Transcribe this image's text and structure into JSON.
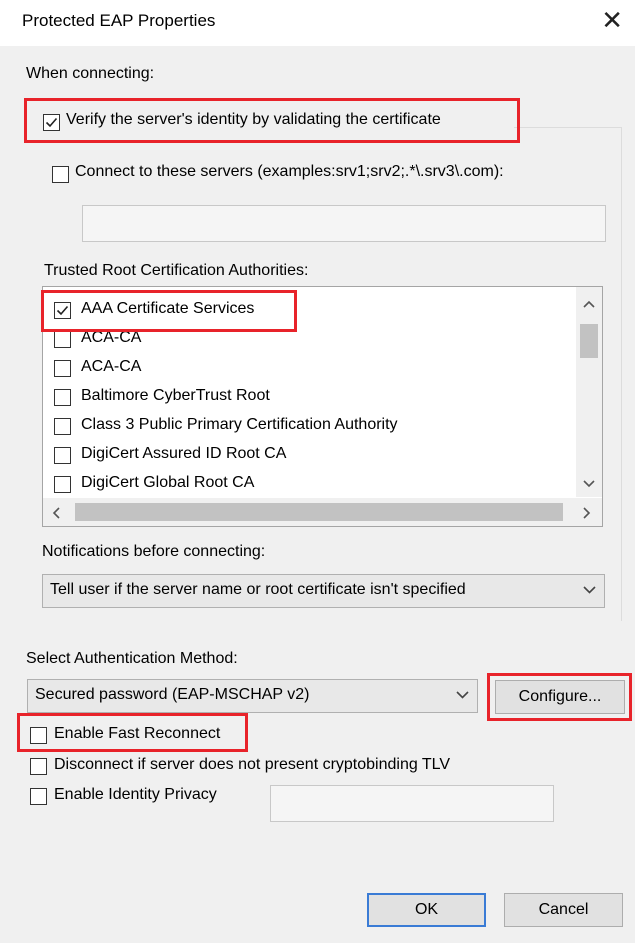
{
  "title": "Protected EAP Properties",
  "close_glyph": "✕",
  "when_connecting_label": "When connecting:",
  "verify_server_label": "Verify the server's identity by validating the certificate",
  "verify_server_checked": true,
  "connect_servers_label": "Connect to these servers (examples:srv1;srv2;.*\\.srv3\\.com):",
  "connect_servers_checked": false,
  "connect_servers_value": "",
  "trusted_root_label": "Trusted Root Certification Authorities:",
  "trusted_roots": [
    {
      "label": "AAA Certificate Services",
      "checked": true
    },
    {
      "label": "ACA-CA",
      "checked": false
    },
    {
      "label": "ACA-CA",
      "checked": false
    },
    {
      "label": "Baltimore CyberTrust Root",
      "checked": false
    },
    {
      "label": "Class 3 Public Primary Certification Authority",
      "checked": false
    },
    {
      "label": "DigiCert Assured ID Root CA",
      "checked": false
    },
    {
      "label": "DigiCert Global Root CA",
      "checked": false
    }
  ],
  "notifications_label": "Notifications before connecting:",
  "notifications_value": "Tell user if the server name or root certificate isn't specified",
  "auth_method_label": "Select Authentication Method:",
  "auth_method_value": "Secured password (EAP-MSCHAP v2)",
  "configure_label": "Configure...",
  "fast_reconnect_label": "Enable Fast Reconnect",
  "fast_reconnect_checked": false,
  "cryptobinding_label": "Disconnect if server does not present cryptobinding TLV",
  "cryptobinding_checked": false,
  "identity_privacy_label": "Enable Identity Privacy",
  "identity_privacy_checked": false,
  "identity_privacy_value": "",
  "ok_label": "OK",
  "cancel_label": "Cancel",
  "highlight_color": "#e8232a",
  "default_button_color": "#3a7bd5"
}
